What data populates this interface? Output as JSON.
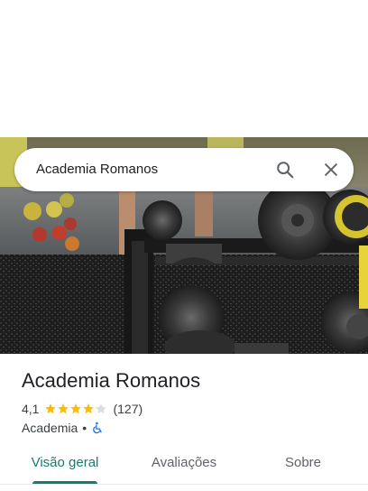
{
  "search": {
    "query": "Academia Romanos",
    "search_icon": "search-icon",
    "close_icon": "close-icon"
  },
  "photo": {
    "description_icon": "place-photo"
  },
  "place": {
    "name": "Academia Romanos",
    "rating": "4,1",
    "rating_value": 4.1,
    "rating_max": 5,
    "review_count": "(127)",
    "category": "Academia",
    "separator": "•",
    "accessibility_icon": "wheelchair-icon"
  },
  "tabs": [
    {
      "label": "Visão geral",
      "active": true
    },
    {
      "label": "Avaliações",
      "active": false
    },
    {
      "label": "Sobre",
      "active": false
    }
  ],
  "colors": {
    "accent": "#1a7a73",
    "star": "#fbbc04",
    "star_empty": "#dadce0",
    "accessibility": "#1a73e8"
  }
}
